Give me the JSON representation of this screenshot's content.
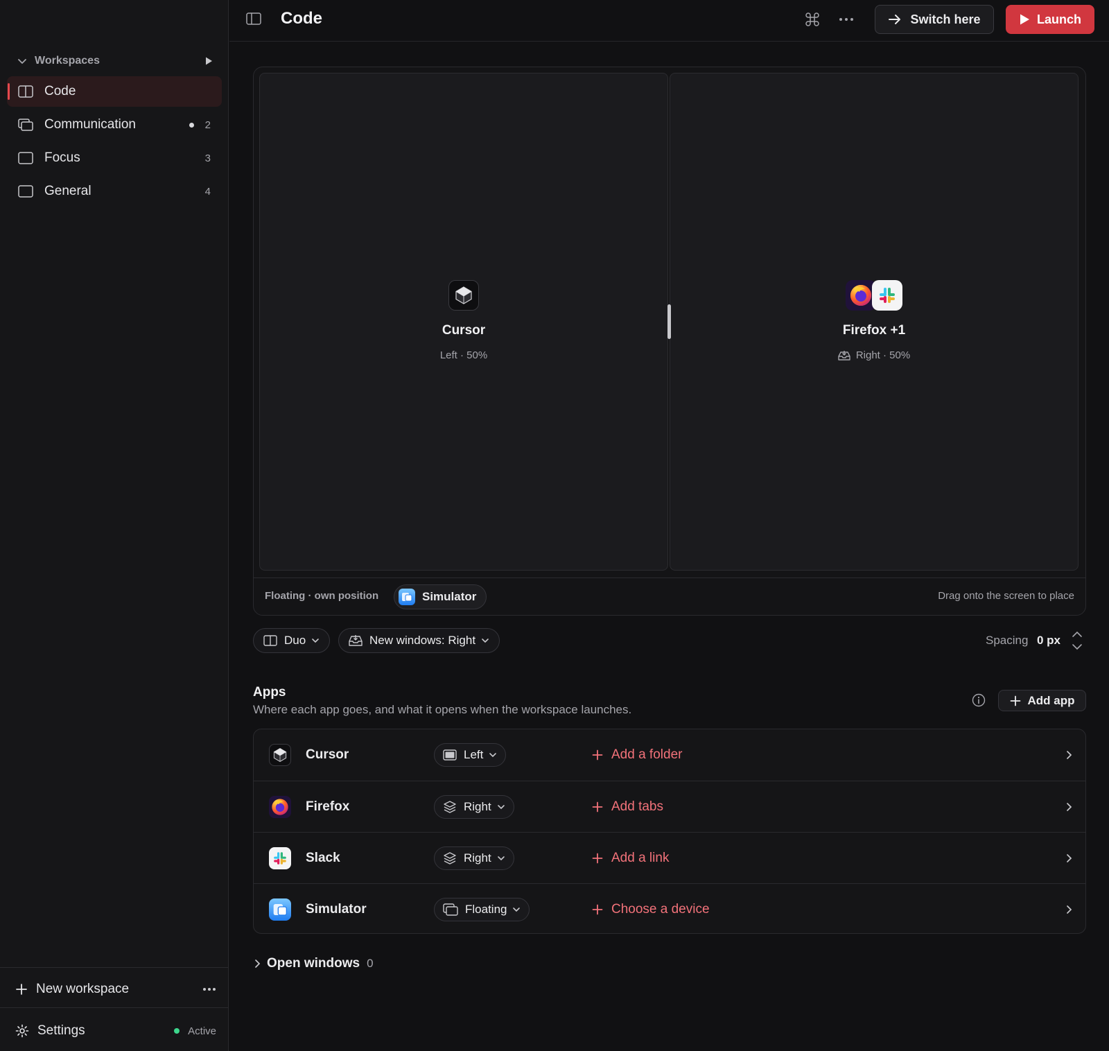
{
  "sidebar": {
    "section_label": "Workspaces",
    "items": [
      {
        "name": "Code",
        "active": true,
        "count": "",
        "icon": "split-layout-icon"
      },
      {
        "name": "Communication",
        "active": false,
        "count": "2",
        "dot": true,
        "icon": "stacked-windows-icon"
      },
      {
        "name": "Focus",
        "active": false,
        "count": "3",
        "icon": "window-icon"
      },
      {
        "name": "General",
        "active": false,
        "count": "4",
        "icon": "window-icon"
      }
    ],
    "new_workspace_label": "New workspace",
    "settings_label": "Settings",
    "status_label": "Active"
  },
  "header": {
    "title": "Code",
    "switch_label": "Switch here",
    "launch_label": "Launch"
  },
  "preview": {
    "left_pane": {
      "name": "Cursor",
      "position": "Left",
      "share": "50%",
      "sub": "Left · 50%"
    },
    "right_pane": {
      "name": "Firefox +1",
      "position": "Right",
      "share": "50%",
      "sub": "Right · 50%"
    },
    "floating_label": "Floating · own position",
    "floating_app": "Simulator",
    "drag_hint": "Drag onto the screen to place"
  },
  "layout_controls": {
    "layout_label": "Duo",
    "new_windows_label": "New windows: Right",
    "spacing_label": "Spacing",
    "spacing_value": "0 px"
  },
  "apps": {
    "title": "Apps",
    "description": "Where each app goes, and what it opens when the workspace launches.",
    "add_app_label": "Add app",
    "rows": [
      {
        "name": "Cursor",
        "position": "Left",
        "action": "Add a folder",
        "icon": "cursor-app-icon"
      },
      {
        "name": "Firefox",
        "position": "Right",
        "action": "Add tabs",
        "icon": "firefox-app-icon"
      },
      {
        "name": "Slack",
        "position": "Right",
        "action": "Add a link",
        "icon": "slack-app-icon"
      },
      {
        "name": "Simulator",
        "position": "Floating",
        "action": "Choose a device",
        "icon": "simulator-app-icon"
      }
    ]
  },
  "open_windows": {
    "label": "Open windows",
    "count": "0"
  },
  "colors": {
    "accent": "#d1373f",
    "accent_text": "#f2727a",
    "status_active": "#3dd68c",
    "background": "#111113"
  }
}
